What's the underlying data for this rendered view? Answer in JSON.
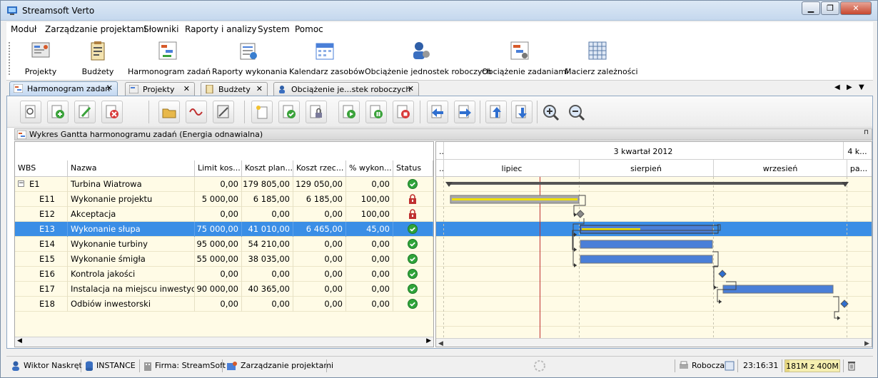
{
  "app": {
    "title": "Streamsoft Verto"
  },
  "menu": [
    "Moduł",
    "Zarządzanie projektami",
    "Słowniki",
    "Raporty i analizy",
    "System",
    "Pomoc"
  ],
  "ribbon": [
    {
      "label": "Projekty",
      "icon": "projects-icon"
    },
    {
      "label": "Budżety",
      "icon": "budget-icon"
    },
    {
      "label": "Harmonogram zadań",
      "icon": "schedule-icon"
    },
    {
      "label": "Raporty wykonania",
      "icon": "reports-icon"
    },
    {
      "label": "Kalendarz zasobów",
      "icon": "calendar-icon"
    },
    {
      "label": "Obciążenie jednostek roboczych",
      "icon": "workers-icon"
    },
    {
      "label": "Obciążenie zadaniami",
      "icon": "tasks-load-icon"
    },
    {
      "label": "Macierz zależności",
      "icon": "matrix-icon"
    }
  ],
  "tabs": [
    {
      "label": "Harmonogram zadań",
      "active": true
    },
    {
      "label": "Projekty",
      "active": false
    },
    {
      "label": "Budżety",
      "active": false
    },
    {
      "label": "Obciążenie je...stek roboczych",
      "active": false
    }
  ],
  "panel": {
    "title": "Wykres Gantta harmonogramu zadań (Energia odnawialna)"
  },
  "grid": {
    "columns": [
      "WBS",
      "Nazwa",
      "Limit kos...",
      "Koszt plan...",
      "Koszt rzec...",
      "% wykon...",
      "Status"
    ],
    "rows": [
      {
        "wbs": "E1",
        "name": "Turbina Wiatrowa",
        "limit": "0,00",
        "plan": "179 805,00",
        "real": "129 050,00",
        "pct": "0,00",
        "status": "ok"
      },
      {
        "wbs": "E11",
        "name": "Wykonanie projektu",
        "limit": "5 000,00",
        "plan": "6 185,00",
        "real": "6 185,00",
        "pct": "100,00",
        "status": "locked"
      },
      {
        "wbs": "E12",
        "name": "Akceptacja",
        "limit": "0,00",
        "plan": "0,00",
        "real": "0,00",
        "pct": "100,00",
        "status": "locked"
      },
      {
        "wbs": "E13",
        "name": "Wykonanie słupa",
        "limit": "75 000,00",
        "plan": "41 010,00",
        "real": "6 465,00",
        "pct": "45,00",
        "status": "ok"
      },
      {
        "wbs": "E14",
        "name": "Wykonanie turbiny",
        "limit": "95 000,00",
        "plan": "54 210,00",
        "real": "0,00",
        "pct": "0,00",
        "status": "ok"
      },
      {
        "wbs": "E15",
        "name": "Wykonanie śmigła",
        "limit": "55 000,00",
        "plan": "38 035,00",
        "real": "0,00",
        "pct": "0,00",
        "status": "ok"
      },
      {
        "wbs": "E16",
        "name": "Kontrola jakości",
        "limit": "0,00",
        "plan": "0,00",
        "real": "0,00",
        "pct": "0,00",
        "status": "ok"
      },
      {
        "wbs": "E17",
        "name": "Instalacja na miejscu inwestycji",
        "limit": "90 000,00",
        "plan": "40 365,00",
        "real": "0,00",
        "pct": "0,00",
        "status": "ok"
      },
      {
        "wbs": "E18",
        "name": "Odbiów inwestorski",
        "limit": "0,00",
        "plan": "0,00",
        "real": "0,00",
        "pct": "0,00",
        "status": "ok"
      }
    ],
    "selected_row": 3
  },
  "gantt": {
    "quarter_prev": "..",
    "quarter": "3 kwartał 2012",
    "quarter_next": "4 k...",
    "months": [
      "..",
      "lipiec",
      "sierpień",
      "wrzesień",
      "pa..."
    ]
  },
  "status": {
    "user": "Wiktor Naskręt",
    "instance": "INSTANCE",
    "company": "Firma: StreamSoft",
    "module": "Zarządzanie projektami",
    "mode": "Robocza",
    "time": "23:16:31",
    "memory": "181M z 400M"
  },
  "colors": {
    "selection": "#3a8ee6",
    "bar": "#4a7fd8",
    "progress": "#f0e000",
    "today": "#c03030",
    "grid_bg": "#fffbe6"
  }
}
